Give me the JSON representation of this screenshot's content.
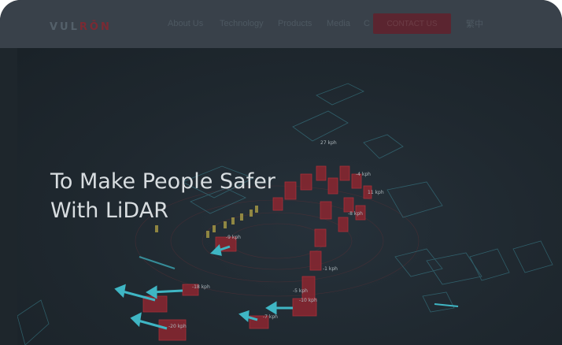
{
  "header": {
    "logo_prefix": "VUL",
    "logo_accent": "RŌN",
    "nav": [
      "About Us",
      "Technology",
      "Products",
      "Media",
      "C"
    ],
    "contact_label": "CONTACT US",
    "language_label": "繁中"
  },
  "hero": {
    "headline_line1": "To Make People Safer",
    "headline_line2": "With LiDAR",
    "speed_labels": [
      "27 kph",
      "-1 kph",
      "-5 kph",
      "-10 kph",
      "-7 kph",
      "-18 kph",
      "-20 kph",
      "-9 kph",
      "-8 kph",
      "-4 kph",
      "11 kph"
    ]
  },
  "colors": {
    "navbar": "#39414a",
    "background": "#1e262c",
    "vehicle_red": "#c0303a",
    "arrow_cyan": "#3fb6c4",
    "pedestrian_yellow": "#d8c24a",
    "headline": "#d8dde0"
  }
}
